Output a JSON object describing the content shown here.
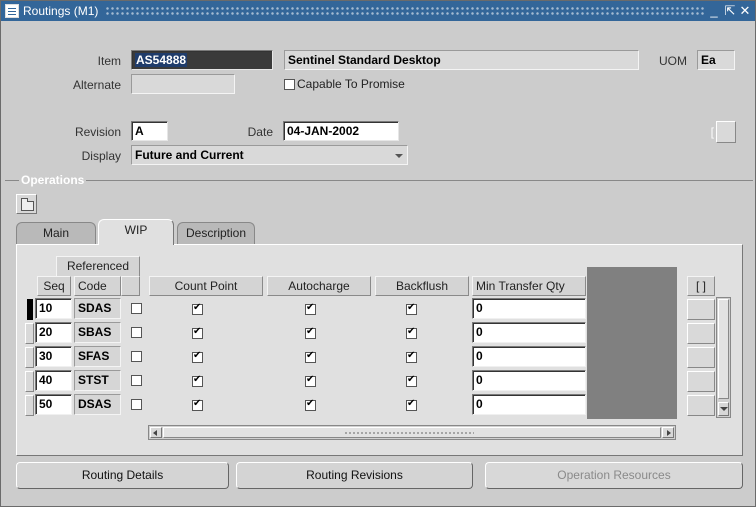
{
  "window": {
    "title": "Routings (M1)",
    "controls": [
      "minimize",
      "restore",
      "close"
    ]
  },
  "header_form": {
    "item_label": "Item",
    "item_value": "AS54888",
    "item_description": "Sentinel Standard Desktop",
    "uom_label": "UOM",
    "uom_value": "Ea",
    "alternate_label": "Alternate",
    "alternate_value": "",
    "capable_to_promise_label": "Capable To Promise",
    "capable_to_promise_checked": false,
    "revision_label": "Revision",
    "revision_value": "A",
    "date_label": "Date",
    "date_value": "04-JAN-2002",
    "display_label": "Display",
    "display_value": "Future and Current",
    "bracket_left": "[",
    "bracket_right": ""
  },
  "operations": {
    "section_title": "Operations",
    "tabs": [
      {
        "label": "Main",
        "active": false
      },
      {
        "label": "WIP",
        "active": true
      },
      {
        "label": "Description",
        "active": false
      }
    ],
    "columns": {
      "seq": "Seq",
      "code": "Code",
      "referenced": "Referenced",
      "count_point": "Count Point",
      "autocharge": "Autocharge",
      "backflush": "Backflush",
      "min_transfer_qty": "Min Transfer Qty",
      "extra": "[ ]"
    },
    "rows": [
      {
        "seq": "10",
        "code": "SDAS",
        "referenced": false,
        "count_point": true,
        "autocharge": true,
        "backflush": true,
        "min_transfer_qty": "0",
        "current": true
      },
      {
        "seq": "20",
        "code": "SBAS",
        "referenced": false,
        "count_point": true,
        "autocharge": true,
        "backflush": true,
        "min_transfer_qty": "0",
        "current": false
      },
      {
        "seq": "30",
        "code": "SFAS",
        "referenced": false,
        "count_point": true,
        "autocharge": true,
        "backflush": true,
        "min_transfer_qty": "0",
        "current": false
      },
      {
        "seq": "40",
        "code": "STST",
        "referenced": false,
        "count_point": true,
        "autocharge": true,
        "backflush": true,
        "min_transfer_qty": "0",
        "current": false
      },
      {
        "seq": "50",
        "code": "DSAS",
        "referenced": false,
        "count_point": true,
        "autocharge": true,
        "backflush": true,
        "min_transfer_qty": "0",
        "current": false
      }
    ]
  },
  "buttons": {
    "routing_details": "Routing Details",
    "routing_revisions": "Routing Revisions",
    "operation_resources": "Operation Resources"
  }
}
